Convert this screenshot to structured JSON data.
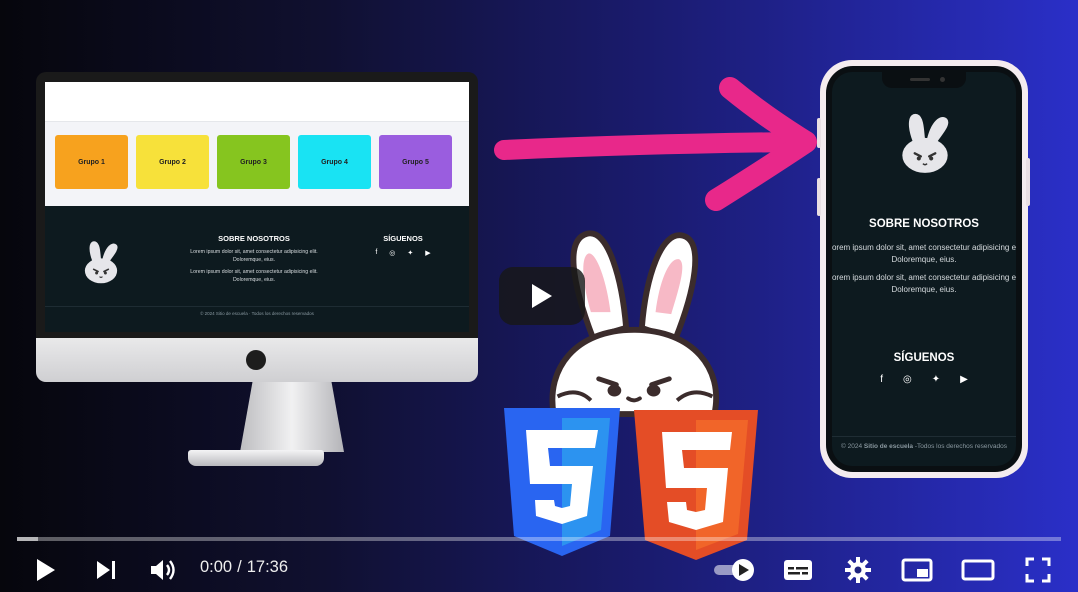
{
  "monitor_page": {
    "groups": [
      {
        "label": "Grupo 1",
        "color": "#f7a21e"
      },
      {
        "label": "Grupo 2",
        "color": "#f7e13a"
      },
      {
        "label": "Grupo 3",
        "color": "#86c51f"
      },
      {
        "label": "Grupo 4",
        "color": "#19e3f3"
      },
      {
        "label": "Grupo 5",
        "color": "#9a5ddf"
      }
    ],
    "about_title": "SOBRE NOSOTROS",
    "about_p1": "Lorem ipsum dolor sit, amet consectetur adipisicing elit. Doloremque, eius.",
    "about_p2": "Lorem ipsum dolor sit, amet consectetur adipisicing elit. Doloremque, eius.",
    "follow_title": "SÍGUENOS",
    "copyright": "© 2024 Sitio de escuela · Todos los derechos reservados"
  },
  "phone_page": {
    "about_title": "SOBRE NOSOTROS",
    "about_p1": "orem ipsum dolor sit, amet consectetur adipisicing e Doloremque, eius.",
    "about_p2": "orem ipsum dolor sit, amet consectetur adipisicing e Doloremque, eius.",
    "follow_title": "SÍGUENOS",
    "copyright_prefix": "© 2024",
    "copyright_site": "Sitio de escuela",
    "copyright_suffix": "-Todos los derechos reservados"
  },
  "social_icons": [
    "facebook-icon",
    "instagram-icon",
    "twitter-icon",
    "youtube-icon"
  ],
  "player": {
    "current_time": "0:00",
    "separator": "/",
    "duration": "17:36",
    "progress_fraction": 0.02,
    "autoplay": true
  },
  "colors": {
    "arrow": "#e8288a",
    "css_blue": "#2965f1",
    "html_orange": "#e44d26",
    "footer_bg": "#0d1a1f"
  }
}
